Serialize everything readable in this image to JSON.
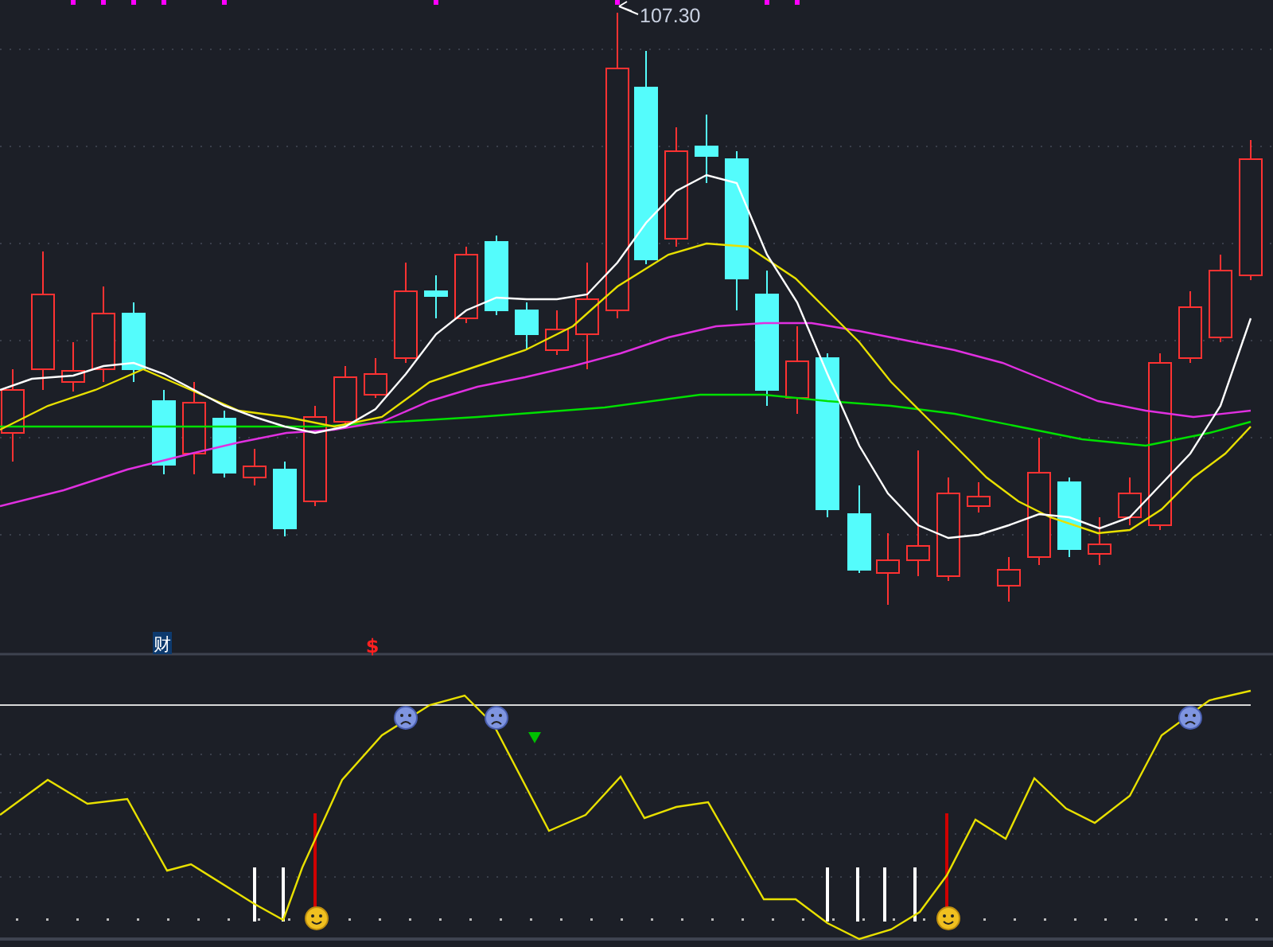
{
  "price_panel": {
    "peak_label": "107.30",
    "event_tags": [
      {
        "kind": "finance",
        "text": "财"
      },
      {
        "kind": "dividend",
        "text": "$"
      }
    ]
  }
}
